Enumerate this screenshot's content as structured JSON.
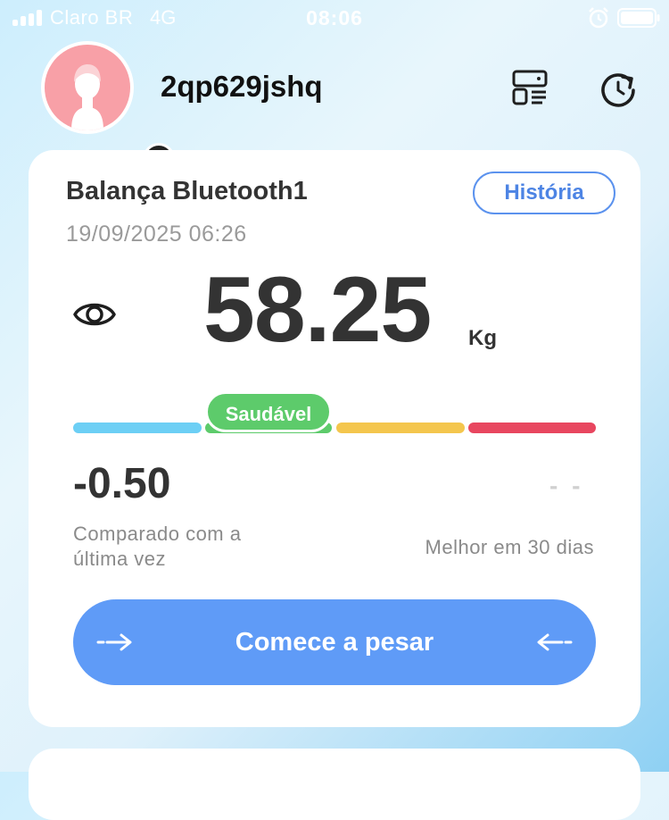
{
  "status": {
    "carrier": "Claro BR",
    "network": "4G",
    "time": "08:06"
  },
  "user": {
    "name": "2qp629jshq"
  },
  "card": {
    "device_name": "Balança Bluetooth1",
    "history_label": "História",
    "datetime": "19/09/2025 06:26",
    "weight": "58.25",
    "unit": "Kg",
    "status_badge": "Saudável",
    "diff_value": "-0.50",
    "diff_label": "Comparado com a última vez",
    "best_value": "- -",
    "best_label": "Melhor em 30 dias",
    "start_label": "Comece a pesar"
  },
  "colors": {
    "accent": "#5f9bf7",
    "underweight": "#6ccff5",
    "healthy": "#5dcb6b",
    "overweight": "#f4c64d",
    "obese": "#e8465f"
  },
  "icons": [
    "alarm-icon",
    "battery-icon",
    "avatar-icon",
    "switch-user-icon",
    "devices-icon",
    "sync-icon",
    "eye-icon",
    "arrow-in-icon"
  ]
}
